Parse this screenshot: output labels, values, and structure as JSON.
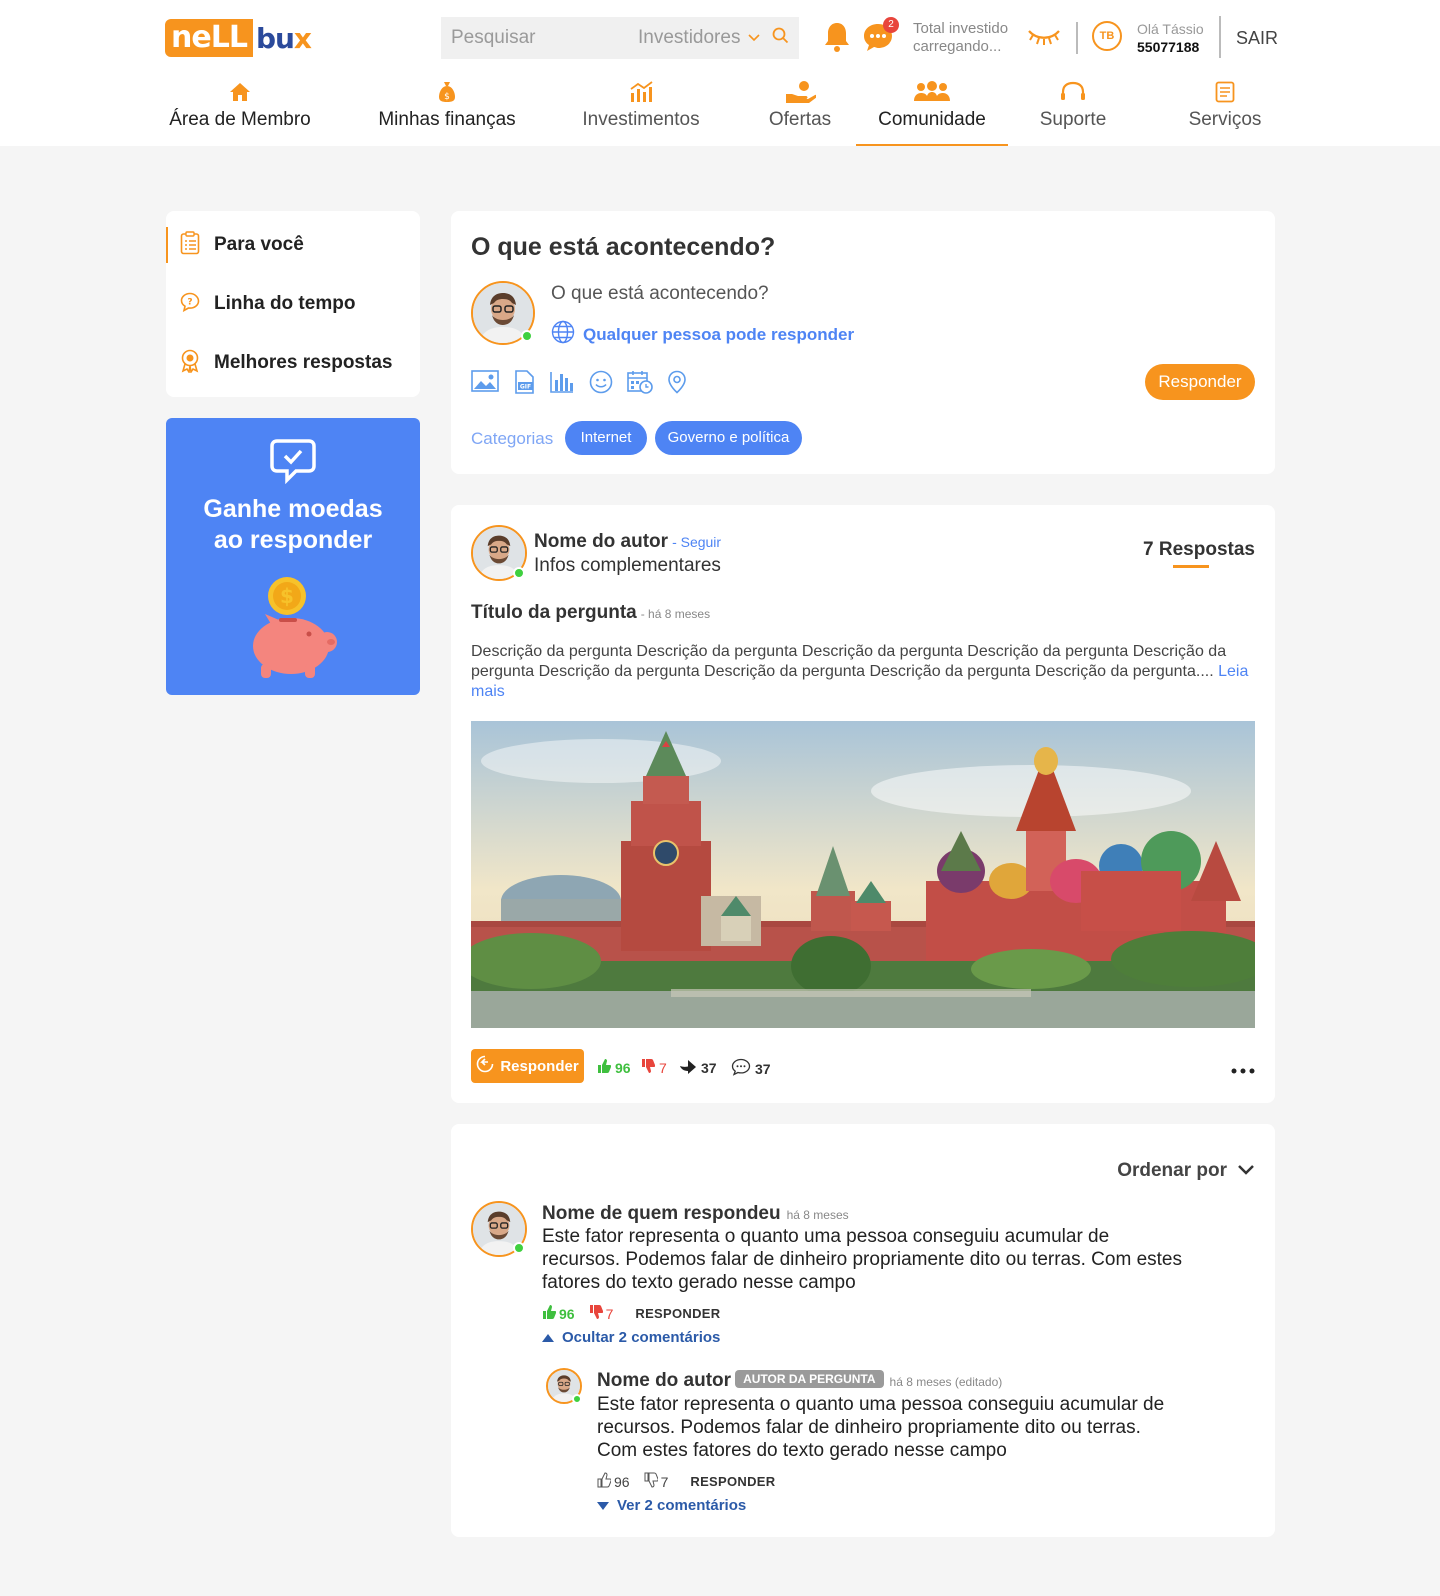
{
  "header": {
    "logo": {
      "part1": "neLL",
      "part2": "bu",
      "part3": "x"
    },
    "search": {
      "placeholder": "Pesquisar",
      "category": "Investidores"
    },
    "notifications_badge": "2",
    "total_invested": {
      "label": "Total investido",
      "value": "carregando..."
    },
    "user": {
      "initials": "TB",
      "greeting": "Olá Tássio",
      "account": "55077188"
    },
    "logout": "SAIR"
  },
  "nav": [
    {
      "label": "Área de Membro",
      "icon": "home-icon"
    },
    {
      "label": "Minhas finanças",
      "icon": "money-bag-icon"
    },
    {
      "label": "Investimentos",
      "icon": "chart-icon"
    },
    {
      "label": "Ofertas",
      "icon": "offer-hand-icon"
    },
    {
      "label": "Comunidade",
      "icon": "community-icon"
    },
    {
      "label": "Suporte",
      "icon": "headset-icon"
    },
    {
      "label": "Serviços",
      "icon": "document-icon"
    }
  ],
  "sidebar": {
    "items": [
      {
        "label": "Para você",
        "icon": "clipboard-icon"
      },
      {
        "label": "Linha do tempo",
        "icon": "question-bubble-icon"
      },
      {
        "label": "Melhores respostas",
        "icon": "award-icon"
      }
    ],
    "promo": {
      "title_line1": "Ganhe moedas",
      "title_line2": "ao responder"
    }
  },
  "compose": {
    "title": "O que está acontecendo?",
    "placeholder": "O que está acontecendo?",
    "audience": "Qualquer pessoa pode responder",
    "tools": [
      "image-icon",
      "gif-icon",
      "poll-icon",
      "emoji-icon",
      "schedule-icon",
      "location-icon"
    ],
    "reply_button": "Responder",
    "categories_label": "Categorias",
    "chips": [
      "Internet",
      "Governo e política"
    ]
  },
  "post": {
    "author": "Nome do autor",
    "follow": "- Seguir",
    "info": "Infos complementares",
    "answers": "7 Respostas",
    "title": "Título da pergunta",
    "time": "- há 8 meses",
    "description": "Descrição da pergunta Descrição da pergunta Descrição da pergunta Descrição da pergunta Descrição da pergunta Descrição da pergunta Descrição da pergunta Descrição da pergunta Descrição da pergunta....",
    "read_more": "Leia mais",
    "reply_button": "Responder",
    "likes": "96",
    "dislikes": "7",
    "shares": "37",
    "comments": "37"
  },
  "answers": {
    "order_label": "Ordenar por",
    "answer": {
      "name": "Nome de quem respondeu",
      "time": "há 8 meses",
      "text": "Este fator representa o quanto uma pessoa conseguiu acumular de recursos. Podemos falar de dinheiro propriamente dito ou terras. Com estes fatores do texto gerado nesse campo",
      "likes": "96",
      "dislikes": "7",
      "reply": "RESPONDER",
      "toggle": "Ocultar 2 comentários"
    },
    "comment": {
      "name": "Nome do autor",
      "tag": "AUTOR DA PERGUNTA",
      "time": "há 8 meses (editado)",
      "text": "Este fator representa o quanto uma pessoa conseguiu acumular de recursos. Podemos falar de dinheiro propriamente dito ou terras. Com estes fatores do texto gerado nesse campo",
      "likes": "96",
      "dislikes": "7",
      "reply": "RESPONDER",
      "toggle": "Ver 2 comentários"
    }
  },
  "colors": {
    "accent": "#f7941e",
    "blue": "#4e84f4",
    "brand_dark": "#2b4a9b",
    "like": "#3fbf3f",
    "dislike": "#e8453c"
  }
}
